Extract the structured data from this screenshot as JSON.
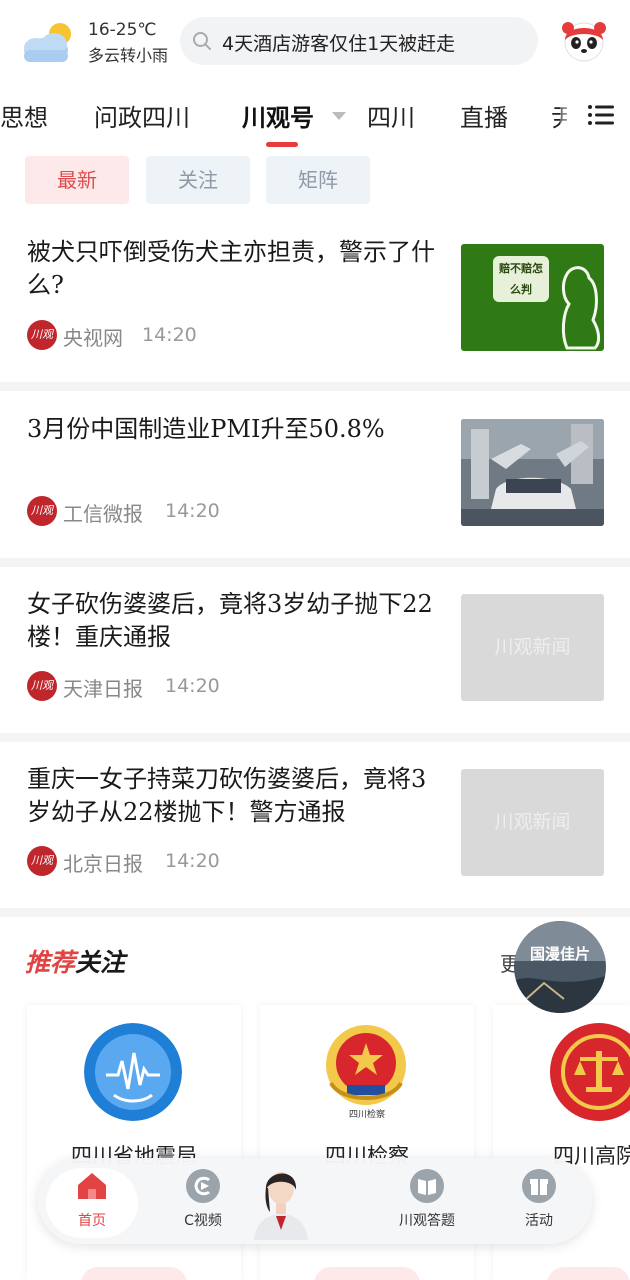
{
  "weather": {
    "temp": "16-25℃",
    "desc": "多云转小雨",
    "icon": "partly-cloudy-icon"
  },
  "search": {
    "text": "4天酒店游客仅住1天被赶走"
  },
  "tabs": [
    {
      "label": "思想"
    },
    {
      "label": "问政四川"
    },
    {
      "label": "川观号"
    },
    {
      "label": "四川"
    },
    {
      "label": "直播"
    },
    {
      "label": "尹"
    }
  ],
  "filters": [
    {
      "label": "最新"
    },
    {
      "label": "关注"
    },
    {
      "label": "矩阵"
    }
  ],
  "news": [
    {
      "title": "被犬只吓倒受伤犬主亦担责，警示了什么?",
      "source": "央视网",
      "time": "14:20",
      "thumb_text": "赔不赔怎么判"
    },
    {
      "title": "3月份中国制造业PMI升至50.8%",
      "source": "工信微报",
      "time": "14:20"
    },
    {
      "title": "女子砍伤婆婆后，竟将3岁幼子抛下22楼！重庆通报",
      "source": "天津日报",
      "time": "14:20",
      "thumb_text": "川观新闻"
    },
    {
      "title": "重庆一女子持菜刀砍伤婆婆后，竟将3岁幼子从22楼抛下！警方通报",
      "source": "北京日报",
      "time": "14:20",
      "thumb_text": "川观新闻"
    }
  ],
  "source_logo_text": "川观",
  "recommend": {
    "title_red": "推荐",
    "title_black": "关注",
    "more": "更",
    "badge_text": "国漫佳片",
    "cards": [
      {
        "name": "四川省地震局"
      },
      {
        "name": "四川检察",
        "logo_caption": "四川检察"
      },
      {
        "name": "四川高院"
      }
    ]
  },
  "bottom_nav": [
    {
      "label": "首页",
      "icon": "home-icon"
    },
    {
      "label": "C视频",
      "icon": "c-video-icon"
    },
    {
      "label": "川观答题",
      "icon": "book-icon"
    },
    {
      "label": "活动",
      "icon": "gift-icon"
    }
  ],
  "colors": {
    "accent": "#e24444",
    "chip_active_bg": "#fde9e9",
    "chip_inactive_bg": "#eef3f8"
  }
}
